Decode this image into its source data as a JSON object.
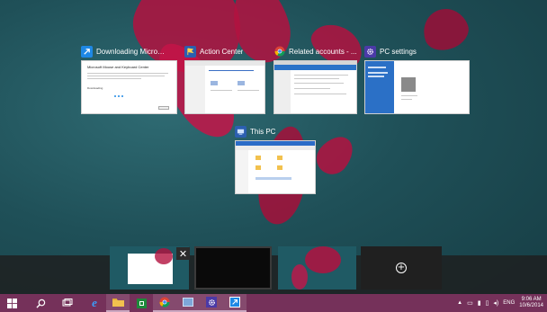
{
  "windows": [
    {
      "title": "Downloading Microsoft...",
      "icon": "download-arrow-icon",
      "doc_heading": "Microsoft Mouse and Keyboard Center",
      "doc_status": "Downloading"
    },
    {
      "title": "Action Center",
      "icon": "action-center-flag-icon"
    },
    {
      "title": "Related accounts - ...",
      "icon": "chrome-icon"
    },
    {
      "title": "PC settings",
      "icon": "gear-icon"
    },
    {
      "title": "This PC",
      "icon": "file-explorer-icon"
    }
  ],
  "virtual_desktops": {
    "close_label": "✕",
    "new_desktop_label": "+"
  },
  "taskbar": {
    "items": [
      "start-button",
      "search-button",
      "task-view-button",
      "internet-explorer",
      "file-explorer",
      "store",
      "chrome",
      "control-panel",
      "settings",
      "download-app"
    ]
  },
  "tray": {
    "language": "ENG",
    "time": "9:06 AM",
    "date": "10/6/2014"
  },
  "colors": {
    "taskbar": "#75315a",
    "accent_blue": "#1e88e5",
    "settings_purple": "#4b3aa7",
    "store_green": "#1d8a3a"
  }
}
